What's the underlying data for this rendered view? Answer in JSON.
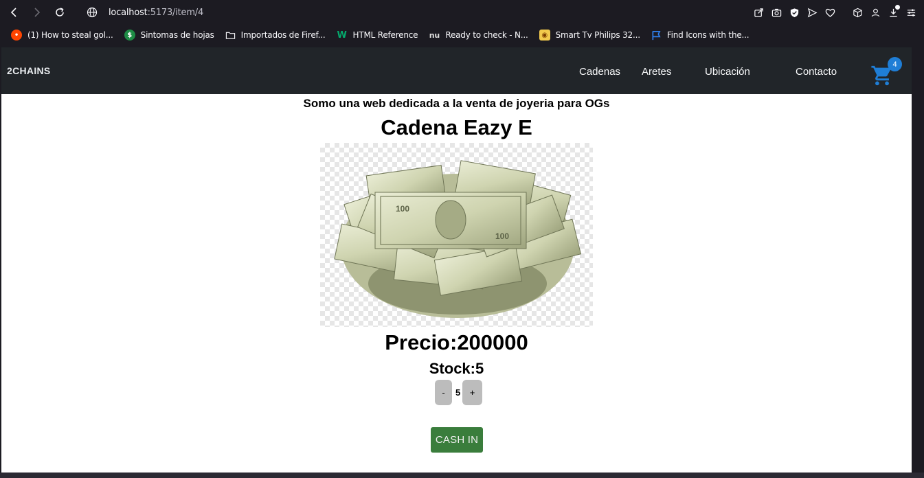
{
  "browser": {
    "url_host": "localhost",
    "url_rest": ":5173/item/4",
    "bookmarks": [
      {
        "label": "(1) How to steal gol...",
        "icon": "reddit-icon",
        "color": "#ff4500"
      },
      {
        "label": "Sintomas de hojas",
        "icon": "dollar-icon",
        "color": "#1e8c45"
      },
      {
        "label": "Importados de Firef...",
        "icon": "folder-icon",
        "color": ""
      },
      {
        "label": "HTML Reference",
        "icon": "w3-icon",
        "color": "#04aa6d"
      },
      {
        "label": "Ready to check - N...",
        "icon": "nu-icon",
        "color": "#dddddd"
      },
      {
        "label": "Smart Tv Philips 32...",
        "icon": "store-icon",
        "color": "#f2c94c"
      },
      {
        "label": "Find Icons with the...",
        "icon": "flag-icon",
        "color": "#2f80ed"
      }
    ]
  },
  "site": {
    "brand": "2CHAINS",
    "nav": [
      "Cadenas",
      "Aretes",
      "Ubicación",
      "Contacto"
    ],
    "cart_count": "4",
    "accent": "#1f7ed6"
  },
  "page": {
    "tagline": "Somo una web dedicada a la venta de joyeria para OGs",
    "title": "Cadena Eazy E",
    "image_alt": "money-stack-image",
    "price": "Precio:200000",
    "stock": "Stock:5",
    "minus": "-",
    "quantity": "5",
    "plus": "+",
    "cash_in": "CASH IN",
    "cash_color": "#3a7d3c"
  }
}
